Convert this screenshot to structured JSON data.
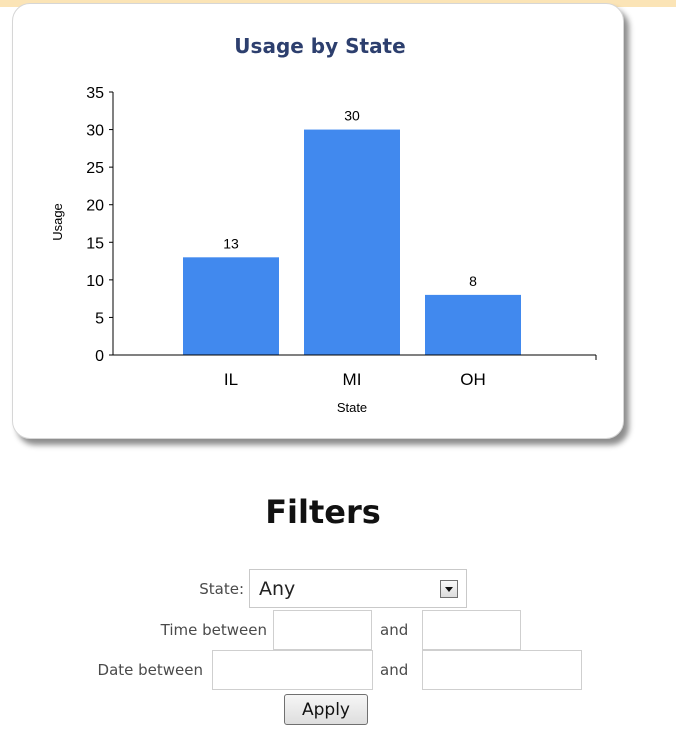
{
  "chart_data": {
    "type": "bar",
    "title": "Usage by State",
    "xlabel": "State",
    "ylabel": "Usage",
    "categories": [
      "IL",
      "MI",
      "OH"
    ],
    "values": [
      13,
      30,
      8
    ],
    "ylim": [
      0,
      35
    ],
    "yticks": [
      0,
      5,
      10,
      15,
      20,
      25,
      30,
      35
    ],
    "bar_color": "#4189ee",
    "grid": false,
    "legend": "none"
  },
  "filters": {
    "title": "Filters",
    "state_label": "State:",
    "state_value": "Any",
    "time_label": "Time between",
    "time_and": "and",
    "time_from": "",
    "time_to": "",
    "date_label": "Date between",
    "date_and": "and",
    "date_from": "",
    "date_to": "",
    "apply_label": "Apply",
    "chevron_icon": "chevron-down-icon"
  },
  "colors": {
    "title": "#2d3f6e",
    "top_strip": "#fbe4b6"
  }
}
